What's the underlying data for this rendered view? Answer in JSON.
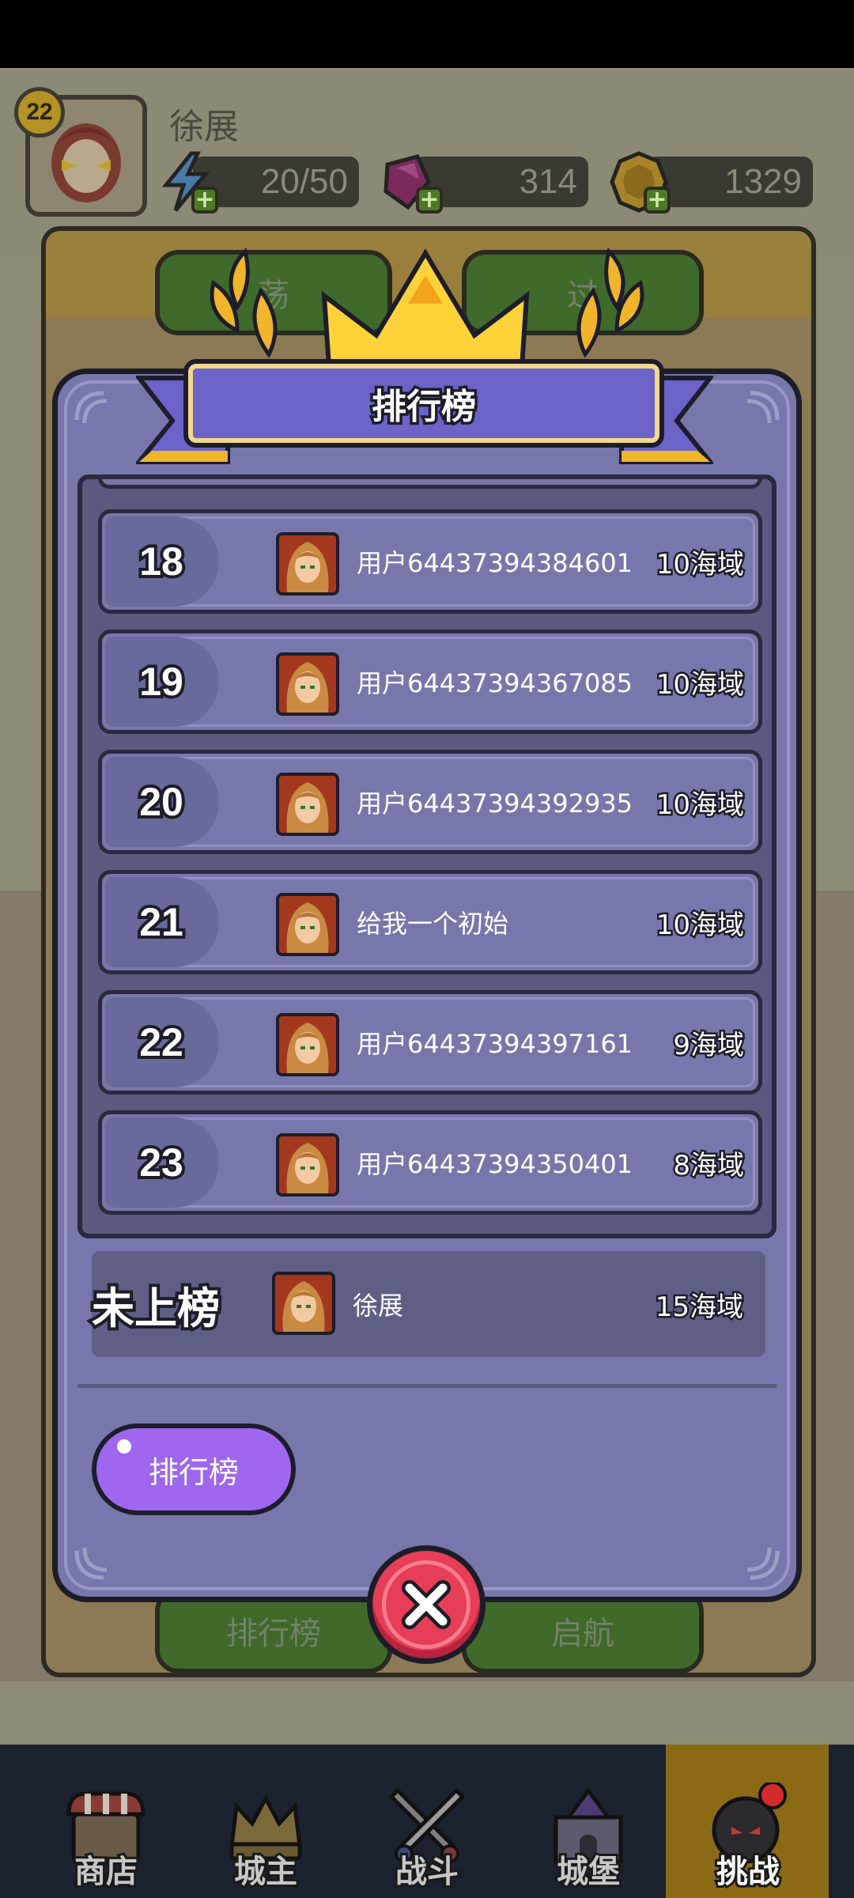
{
  "player": {
    "name": "徐展",
    "level": "22",
    "energy": "20/50",
    "gems": "314",
    "coins": "1329"
  },
  "background_buttons": {
    "top_left": "荡",
    "top_right": "过",
    "bottom_left": "排行榜",
    "bottom_right": "启航"
  },
  "leaderboard": {
    "title": "排行榜",
    "rows": [
      {
        "rank": "18",
        "name": "用户64437394384601",
        "score": "10海域"
      },
      {
        "rank": "19",
        "name": "用户64437394367085",
        "score": "10海域"
      },
      {
        "rank": "20",
        "name": "用户64437394392935",
        "score": "10海域"
      },
      {
        "rank": "21",
        "name": "给我一个初始",
        "score": "10海域"
      },
      {
        "rank": "22",
        "name": "用户64437394397161",
        "score": "9海域"
      },
      {
        "rank": "23",
        "name": "用户64437394350401",
        "score": "8海域"
      }
    ],
    "my_entry": {
      "rank_label": "未上榜",
      "name": "徐展",
      "score": "15海域"
    },
    "tab_button": "排行榜"
  },
  "bottom_nav": [
    {
      "label": "商店",
      "icon": "shop-icon"
    },
    {
      "label": "城主",
      "icon": "crown-icon"
    },
    {
      "label": "战斗",
      "icon": "crossed-swords-icon"
    },
    {
      "label": "城堡",
      "icon": "castle-icon"
    },
    {
      "label": "挑战",
      "icon": "bomb-monster-icon"
    }
  ],
  "colors": {
    "panel": "#7877ab",
    "panel_dark": "#5a5980",
    "ribbon": "#6b63c8",
    "tab_button": "#a066f0",
    "close_button": "#e53e56",
    "nav_active": "#8c6a15"
  }
}
